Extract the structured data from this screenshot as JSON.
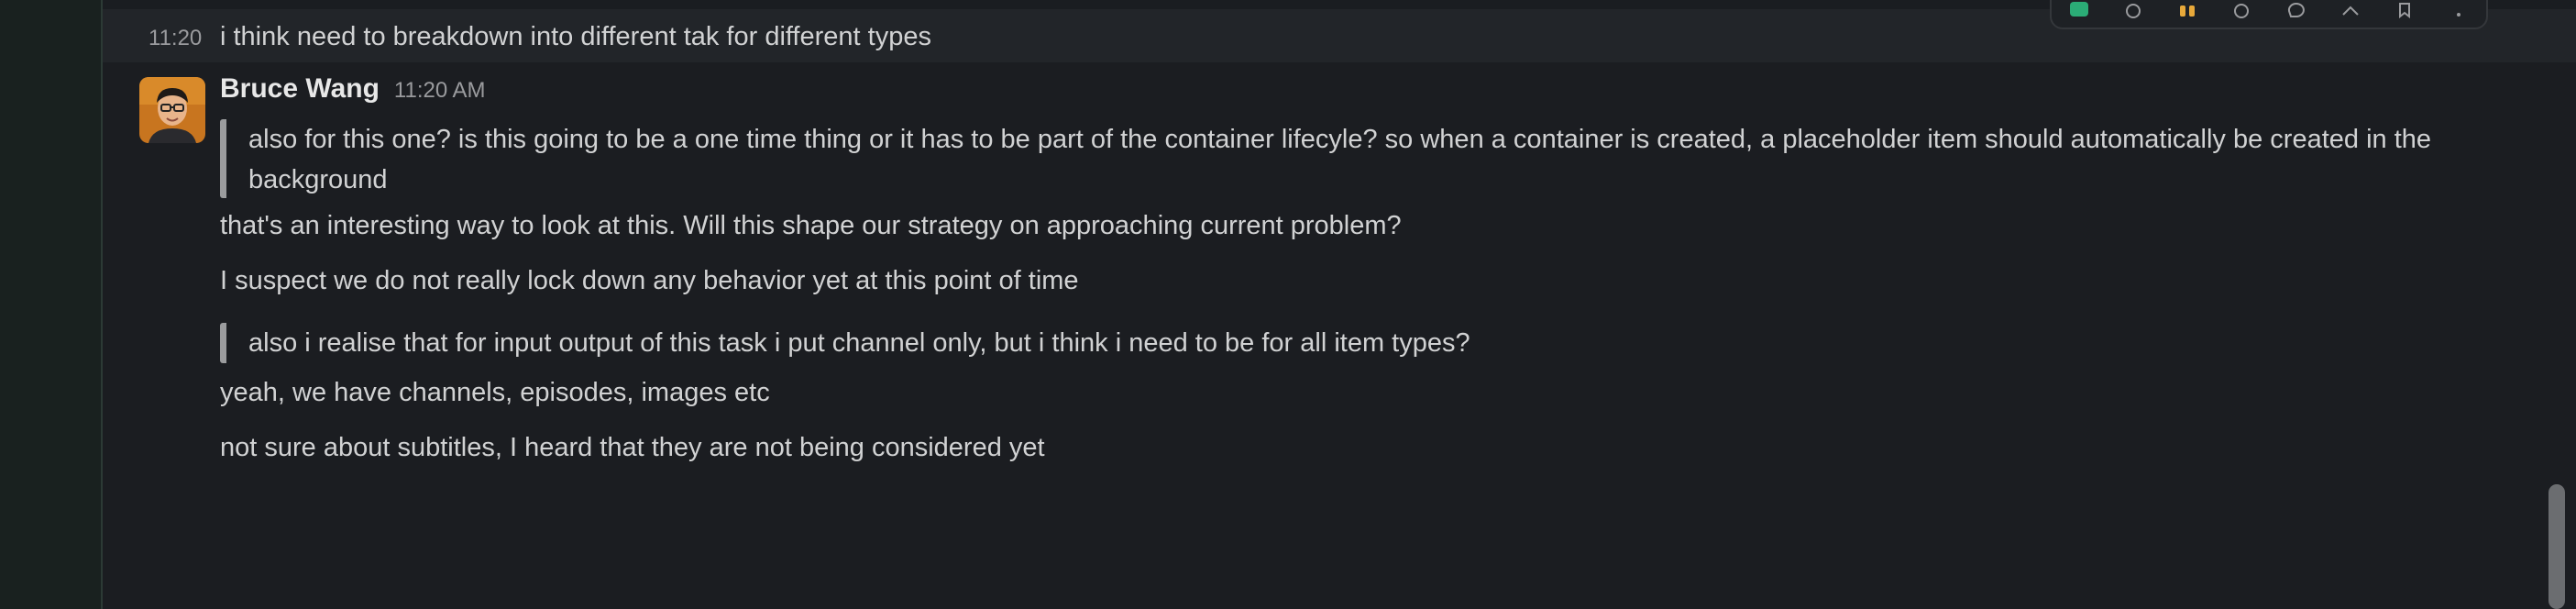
{
  "messages": {
    "prev_time": "11:20",
    "prev_text": "i think need to breakdown into different tak for different types",
    "author": "Bruce Wang",
    "author_time": "11:20 AM",
    "quote1": "also for this one? is this going to be a one time thing or it has to be part of the container lifecyle? so when a container is created, a placeholder item should automatically be created in the background",
    "line1": "that's an interesting way to look at this. Will this shape our strategy on approaching current problem?",
    "line2": "I suspect we do not really lock down any behavior yet at this point of time",
    "quote2": "also i realise that for input output of this task i put channel only, but i think i need to be for all item types?",
    "line3": "yeah, we have channels, episodes, images etc",
    "line4": "not sure about subtitles, I heard that they are not being considered yet"
  },
  "toolbar": {
    "icons": [
      "check-reaction-icon",
      "emoji-icon",
      "raised-hands-icon",
      "add-reaction-icon",
      "reply-thread-icon",
      "forward-icon",
      "bookmark-icon",
      "more-icon"
    ]
  },
  "colors": {
    "background": "#1b1d21",
    "hover_row": "#222529",
    "rail": "#19211f",
    "quote_bar": "#9b9c9e",
    "check_green": "#2bac76",
    "hands_yellow": "#e8a93a"
  }
}
